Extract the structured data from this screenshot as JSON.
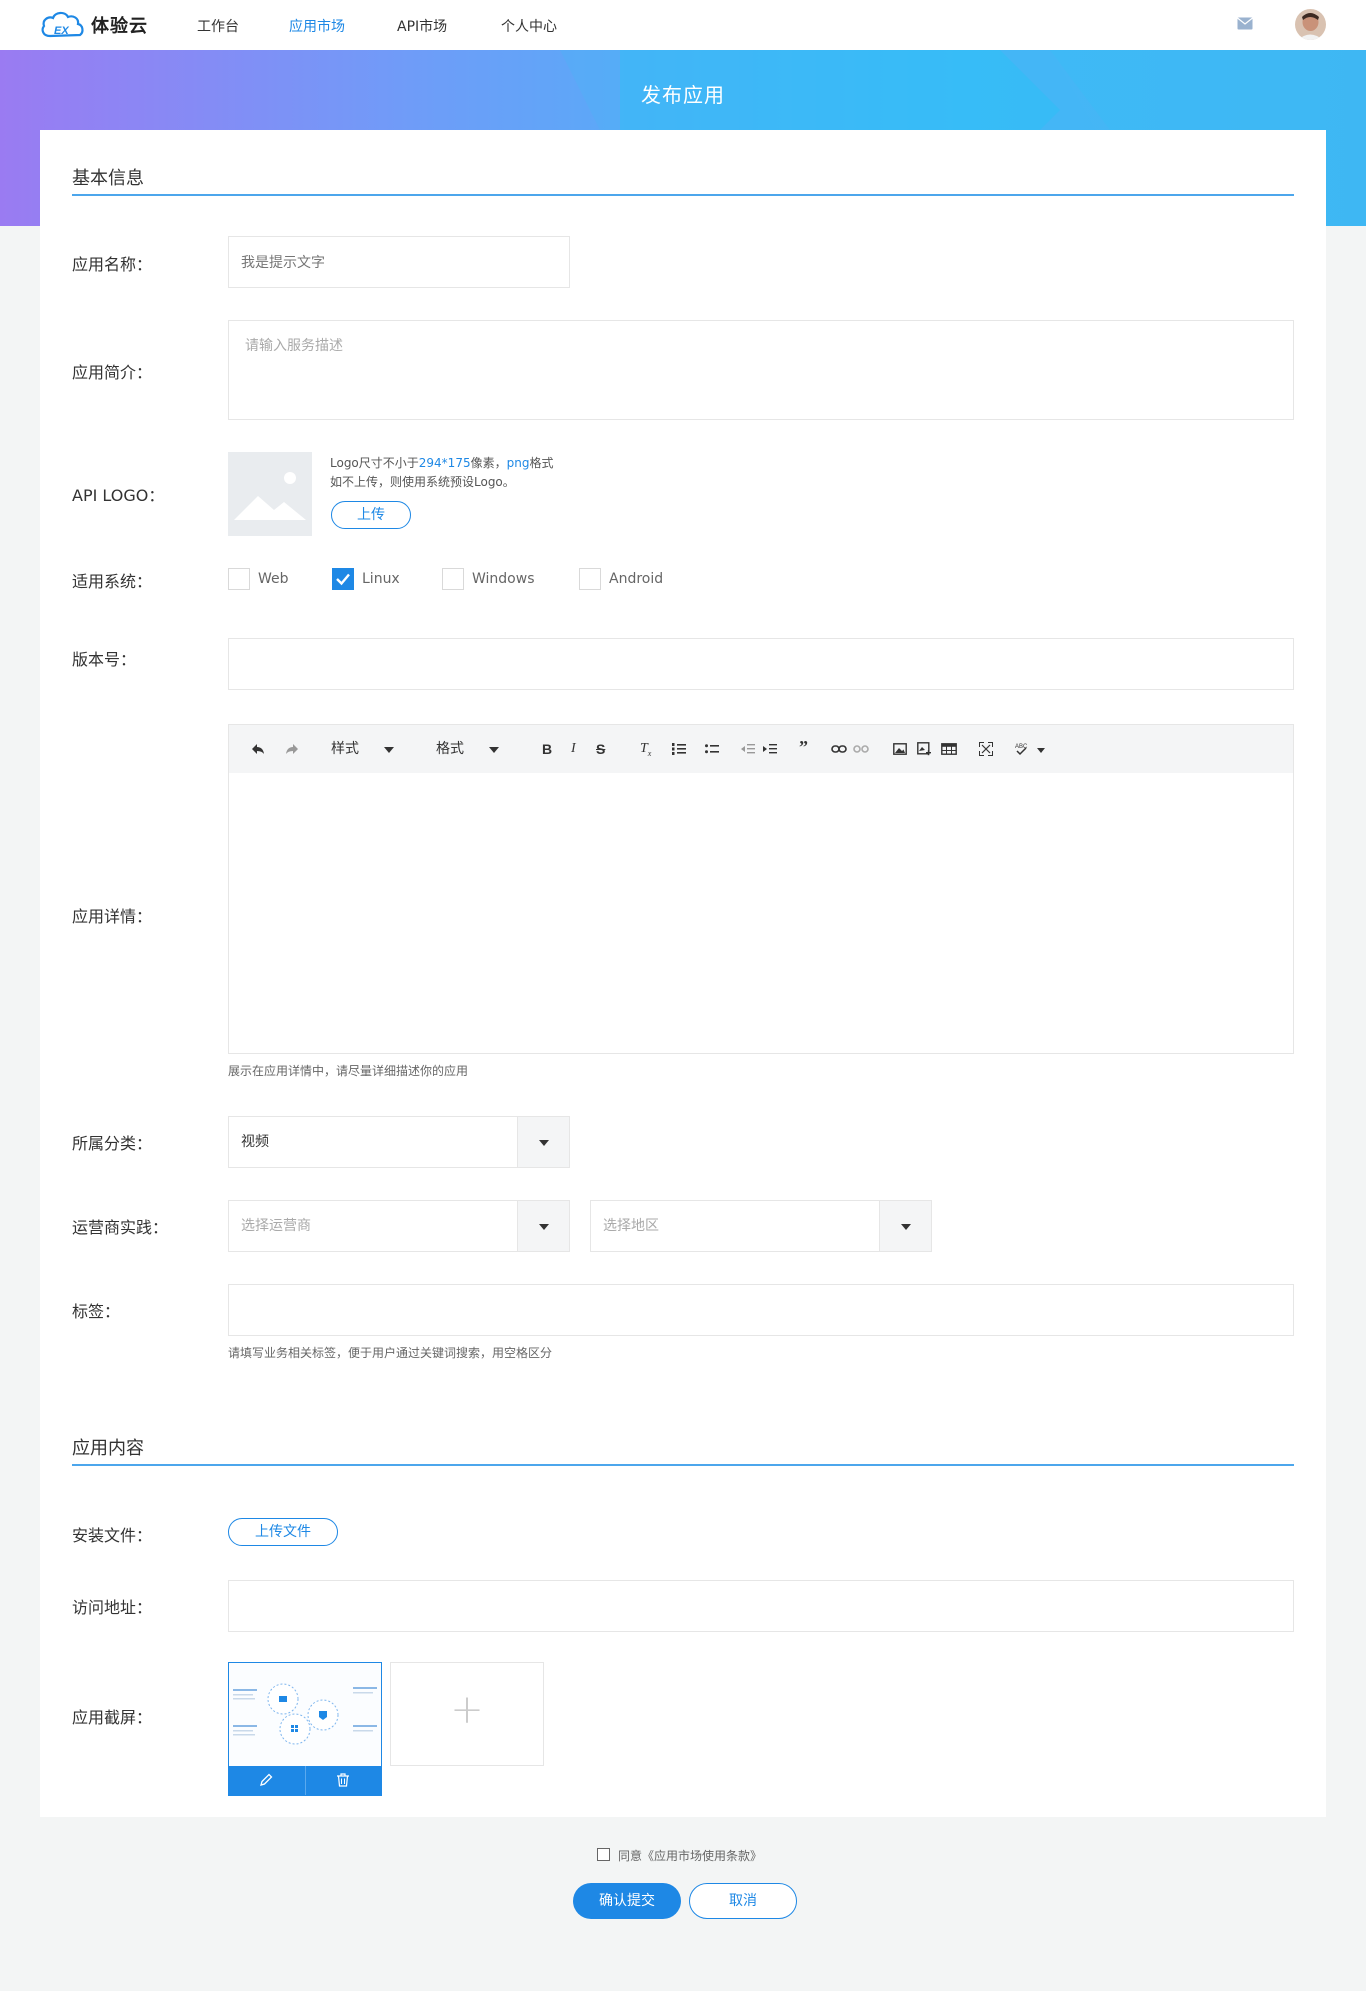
{
  "brand": {
    "name": "体验云",
    "logo_text": "EX"
  },
  "nav": {
    "items": [
      {
        "label": "工作台"
      },
      {
        "label": "应用市场"
      },
      {
        "label": "API市场"
      },
      {
        "label": "个人中心"
      }
    ],
    "active": "应用市场"
  },
  "banner": {
    "title": "发布应用"
  },
  "sections": {
    "basic": "基本信息",
    "content": "应用内容"
  },
  "form": {
    "app_name": {
      "label": "应用名称：",
      "placeholder": "我是提示文字"
    },
    "app_intro": {
      "label": "应用简介：",
      "placeholder": "请输入服务描述"
    },
    "api_logo": {
      "label": "API LOGO：",
      "hint_prefix": "Logo尺寸不小于",
      "hint_size": "294*175",
      "hint_mid": "像素，",
      "hint_format": "png",
      "hint_suffix": "格式",
      "hint_line2": "如不上传，则使用系统预设Logo。",
      "upload_label": "上传"
    },
    "systems": {
      "label": "适用系统：",
      "options": [
        {
          "label": "Web",
          "checked": false
        },
        {
          "label": "Linux",
          "checked": true
        },
        {
          "label": "Windows",
          "checked": false
        },
        {
          "label": "Android",
          "checked": false
        }
      ]
    },
    "version": {
      "label": "版本号：",
      "value": ""
    },
    "detail": {
      "label": "应用详情：",
      "toolbar": {
        "style": "样式",
        "format": "格式"
      },
      "hint": "展示在应用详情中，请尽量详细描述你的应用"
    },
    "category": {
      "label": "所属分类：",
      "value": "视频"
    },
    "operator": {
      "label": "运营商实践：",
      "operator_placeholder": "选择运营商",
      "region_placeholder": "选择地区"
    },
    "tags": {
      "label": "标签：",
      "value": "",
      "hint": "请填写业务相关标签，便于用户通过关键词搜索，用空格区分"
    },
    "install_file": {
      "label": "安装文件：",
      "upload_label": "上传文件"
    },
    "access_url": {
      "label": "访问地址：",
      "value": ""
    },
    "screenshots": {
      "label": "应用截屏：",
      "add_symbol": "+"
    }
  },
  "footer": {
    "agree_text": "同意《应用市场使用条款》",
    "submit_label": "确认提交",
    "cancel_label": "取消"
  },
  "colors": {
    "accent": "#1e88e5",
    "banner_start": "#9a7bf2",
    "banner_end": "#3ab7f2"
  }
}
